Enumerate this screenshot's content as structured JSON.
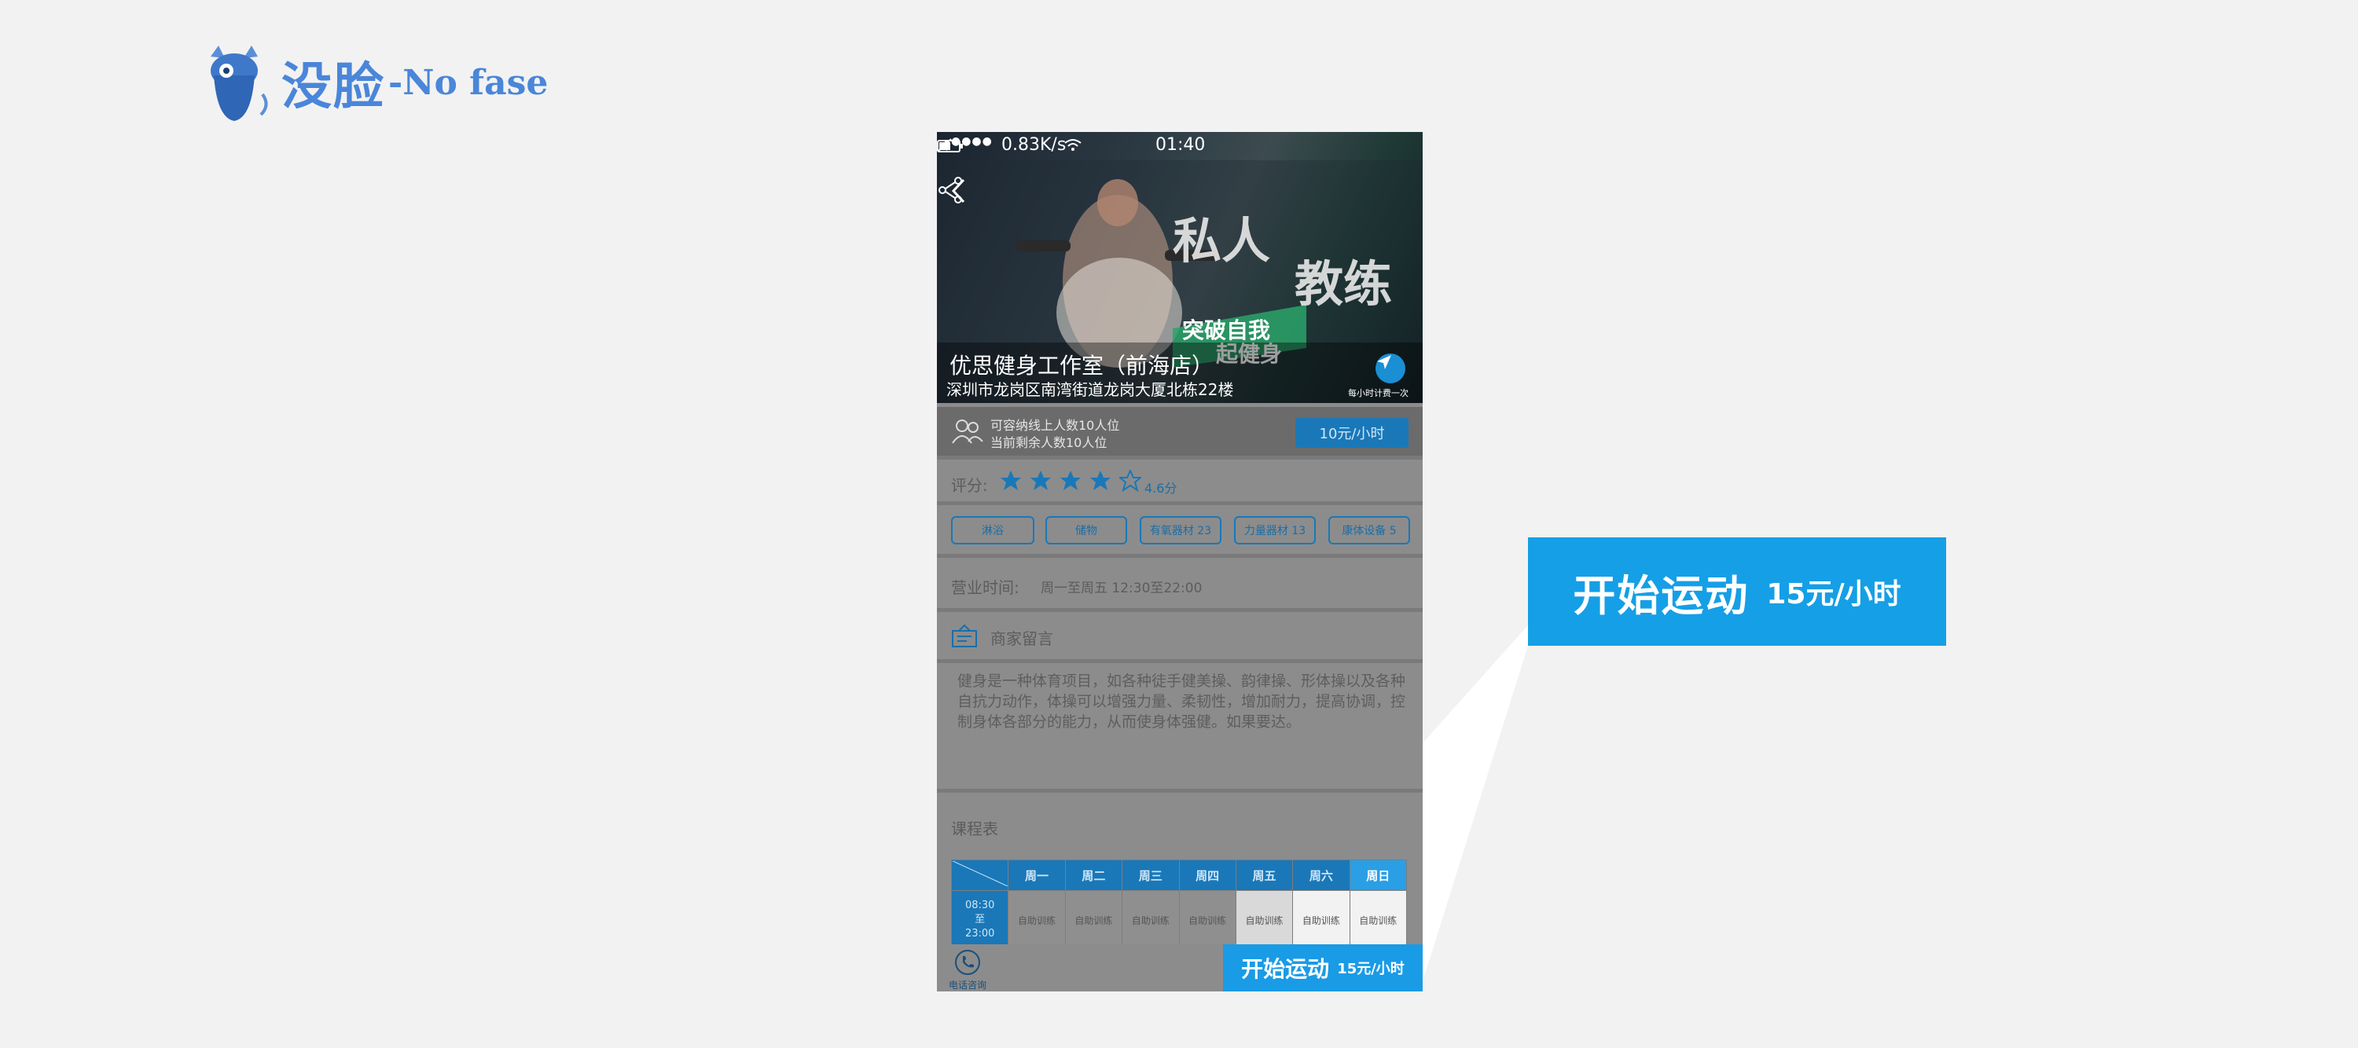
{
  "brand": {
    "name_cn": "没脸",
    "name_en": "-No fase"
  },
  "statusbar": {
    "signal": "●●●●",
    "speed": "0.83K/s",
    "time": "01:40"
  },
  "hero": {
    "banner_text_1": "私人",
    "banner_text_2": "教练",
    "banner_slogan_1": "突破自我",
    "banner_slogan_2": "起健身",
    "store_name": "优思健身工作室（前海店）",
    "address": "深圳市龙岗区南湾街道龙岗大厦北栋22楼",
    "nav_note": "每小时计费一次"
  },
  "capacity": {
    "line1": "可容纳线上人数10人位",
    "line2": "当前剩余人数10人位",
    "price": "10元/小时"
  },
  "rating": {
    "label": "评分:",
    "value": "4.6分",
    "stars": 4,
    "max": 5
  },
  "tags": [
    "淋浴",
    "储物",
    "有氧器材 23",
    "力量器材 13",
    "康体设备 5"
  ],
  "hours": {
    "label": "营业时间:",
    "value": "周一至周五 12:30至22:00"
  },
  "message": {
    "title": "商家留言",
    "body": "健身是一种体育项目，如各种徒手健美操、韵律操、形体操以及各种自抗力动作，体操可以增强力量、柔韧性，增加耐力，提高协调，控制身体各部分的能力，从而使身体强健。如果要达。"
  },
  "schedule": {
    "title": "课程表",
    "days": [
      "周一",
      "周二",
      "周三",
      "周四",
      "周五",
      "周六",
      "周日"
    ],
    "time_slot": [
      "08:30",
      "至",
      "23:00"
    ],
    "cells": [
      "自助训练",
      "自助训练",
      "自助训练",
      "自助训练",
      "自助训练",
      "自助训练",
      "自助训练"
    ]
  },
  "bottom": {
    "call_label": "电话咨询",
    "start_label": "开始运动",
    "start_price": "15元/小时"
  },
  "callout": {
    "start_label": "开始运动",
    "start_price": "15元/小时"
  },
  "colors": {
    "accent": "#1a9be6",
    "brand": "#4a86d9",
    "overlay": "#8c8c8c"
  }
}
